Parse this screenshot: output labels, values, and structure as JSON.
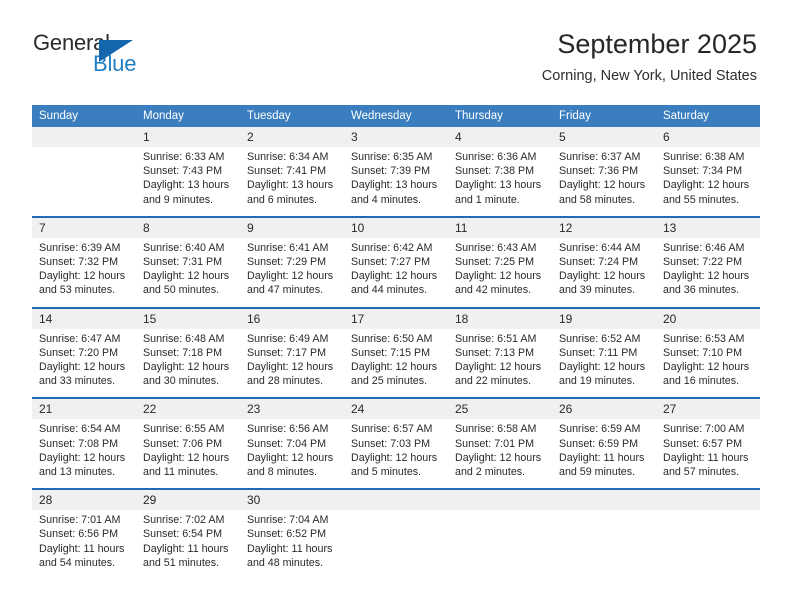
{
  "brand": {
    "line1": "General",
    "line2": "Blue"
  },
  "header": {
    "title": "September 2025",
    "subtitle": "Corning, New York, United States"
  },
  "colors": {
    "header_blue": "#3a7ebf",
    "rule_blue": "#1f6cb0",
    "brand_blue": "#1f7fc4",
    "band_gray": "#f0f0f0"
  },
  "weekday_headers": [
    "Sunday",
    "Monday",
    "Tuesday",
    "Wednesday",
    "Thursday",
    "Friday",
    "Saturday"
  ],
  "weeks": [
    [
      {
        "day": "",
        "sunrise": "",
        "sunset": "",
        "daylight_a": "",
        "daylight_b": ""
      },
      {
        "day": "1",
        "sunrise": "Sunrise: 6:33 AM",
        "sunset": "Sunset: 7:43 PM",
        "daylight_a": "Daylight: 13 hours",
        "daylight_b": "and 9 minutes."
      },
      {
        "day": "2",
        "sunrise": "Sunrise: 6:34 AM",
        "sunset": "Sunset: 7:41 PM",
        "daylight_a": "Daylight: 13 hours",
        "daylight_b": "and 6 minutes."
      },
      {
        "day": "3",
        "sunrise": "Sunrise: 6:35 AM",
        "sunset": "Sunset: 7:39 PM",
        "daylight_a": "Daylight: 13 hours",
        "daylight_b": "and 4 minutes."
      },
      {
        "day": "4",
        "sunrise": "Sunrise: 6:36 AM",
        "sunset": "Sunset: 7:38 PM",
        "daylight_a": "Daylight: 13 hours",
        "daylight_b": "and 1 minute."
      },
      {
        "day": "5",
        "sunrise": "Sunrise: 6:37 AM",
        "sunset": "Sunset: 7:36 PM",
        "daylight_a": "Daylight: 12 hours",
        "daylight_b": "and 58 minutes."
      },
      {
        "day": "6",
        "sunrise": "Sunrise: 6:38 AM",
        "sunset": "Sunset: 7:34 PM",
        "daylight_a": "Daylight: 12 hours",
        "daylight_b": "and 55 minutes."
      }
    ],
    [
      {
        "day": "7",
        "sunrise": "Sunrise: 6:39 AM",
        "sunset": "Sunset: 7:32 PM",
        "daylight_a": "Daylight: 12 hours",
        "daylight_b": "and 53 minutes."
      },
      {
        "day": "8",
        "sunrise": "Sunrise: 6:40 AM",
        "sunset": "Sunset: 7:31 PM",
        "daylight_a": "Daylight: 12 hours",
        "daylight_b": "and 50 minutes."
      },
      {
        "day": "9",
        "sunrise": "Sunrise: 6:41 AM",
        "sunset": "Sunset: 7:29 PM",
        "daylight_a": "Daylight: 12 hours",
        "daylight_b": "and 47 minutes."
      },
      {
        "day": "10",
        "sunrise": "Sunrise: 6:42 AM",
        "sunset": "Sunset: 7:27 PM",
        "daylight_a": "Daylight: 12 hours",
        "daylight_b": "and 44 minutes."
      },
      {
        "day": "11",
        "sunrise": "Sunrise: 6:43 AM",
        "sunset": "Sunset: 7:25 PM",
        "daylight_a": "Daylight: 12 hours",
        "daylight_b": "and 42 minutes."
      },
      {
        "day": "12",
        "sunrise": "Sunrise: 6:44 AM",
        "sunset": "Sunset: 7:24 PM",
        "daylight_a": "Daylight: 12 hours",
        "daylight_b": "and 39 minutes."
      },
      {
        "day": "13",
        "sunrise": "Sunrise: 6:46 AM",
        "sunset": "Sunset: 7:22 PM",
        "daylight_a": "Daylight: 12 hours",
        "daylight_b": "and 36 minutes."
      }
    ],
    [
      {
        "day": "14",
        "sunrise": "Sunrise: 6:47 AM",
        "sunset": "Sunset: 7:20 PM",
        "daylight_a": "Daylight: 12 hours",
        "daylight_b": "and 33 minutes."
      },
      {
        "day": "15",
        "sunrise": "Sunrise: 6:48 AM",
        "sunset": "Sunset: 7:18 PM",
        "daylight_a": "Daylight: 12 hours",
        "daylight_b": "and 30 minutes."
      },
      {
        "day": "16",
        "sunrise": "Sunrise: 6:49 AM",
        "sunset": "Sunset: 7:17 PM",
        "daylight_a": "Daylight: 12 hours",
        "daylight_b": "and 28 minutes."
      },
      {
        "day": "17",
        "sunrise": "Sunrise: 6:50 AM",
        "sunset": "Sunset: 7:15 PM",
        "daylight_a": "Daylight: 12 hours",
        "daylight_b": "and 25 minutes."
      },
      {
        "day": "18",
        "sunrise": "Sunrise: 6:51 AM",
        "sunset": "Sunset: 7:13 PM",
        "daylight_a": "Daylight: 12 hours",
        "daylight_b": "and 22 minutes."
      },
      {
        "day": "19",
        "sunrise": "Sunrise: 6:52 AM",
        "sunset": "Sunset: 7:11 PM",
        "daylight_a": "Daylight: 12 hours",
        "daylight_b": "and 19 minutes."
      },
      {
        "day": "20",
        "sunrise": "Sunrise: 6:53 AM",
        "sunset": "Sunset: 7:10 PM",
        "daylight_a": "Daylight: 12 hours",
        "daylight_b": "and 16 minutes."
      }
    ],
    [
      {
        "day": "21",
        "sunrise": "Sunrise: 6:54 AM",
        "sunset": "Sunset: 7:08 PM",
        "daylight_a": "Daylight: 12 hours",
        "daylight_b": "and 13 minutes."
      },
      {
        "day": "22",
        "sunrise": "Sunrise: 6:55 AM",
        "sunset": "Sunset: 7:06 PM",
        "daylight_a": "Daylight: 12 hours",
        "daylight_b": "and 11 minutes."
      },
      {
        "day": "23",
        "sunrise": "Sunrise: 6:56 AM",
        "sunset": "Sunset: 7:04 PM",
        "daylight_a": "Daylight: 12 hours",
        "daylight_b": "and 8 minutes."
      },
      {
        "day": "24",
        "sunrise": "Sunrise: 6:57 AM",
        "sunset": "Sunset: 7:03 PM",
        "daylight_a": "Daylight: 12 hours",
        "daylight_b": "and 5 minutes."
      },
      {
        "day": "25",
        "sunrise": "Sunrise: 6:58 AM",
        "sunset": "Sunset: 7:01 PM",
        "daylight_a": "Daylight: 12 hours",
        "daylight_b": "and 2 minutes."
      },
      {
        "day": "26",
        "sunrise": "Sunrise: 6:59 AM",
        "sunset": "Sunset: 6:59 PM",
        "daylight_a": "Daylight: 11 hours",
        "daylight_b": "and 59 minutes."
      },
      {
        "day": "27",
        "sunrise": "Sunrise: 7:00 AM",
        "sunset": "Sunset: 6:57 PM",
        "daylight_a": "Daylight: 11 hours",
        "daylight_b": "and 57 minutes."
      }
    ],
    [
      {
        "day": "28",
        "sunrise": "Sunrise: 7:01 AM",
        "sunset": "Sunset: 6:56 PM",
        "daylight_a": "Daylight: 11 hours",
        "daylight_b": "and 54 minutes."
      },
      {
        "day": "29",
        "sunrise": "Sunrise: 7:02 AM",
        "sunset": "Sunset: 6:54 PM",
        "daylight_a": "Daylight: 11 hours",
        "daylight_b": "and 51 minutes."
      },
      {
        "day": "30",
        "sunrise": "Sunrise: 7:04 AM",
        "sunset": "Sunset: 6:52 PM",
        "daylight_a": "Daylight: 11 hours",
        "daylight_b": "and 48 minutes."
      },
      {
        "day": "",
        "sunrise": "",
        "sunset": "",
        "daylight_a": "",
        "daylight_b": ""
      },
      {
        "day": "",
        "sunrise": "",
        "sunset": "",
        "daylight_a": "",
        "daylight_b": ""
      },
      {
        "day": "",
        "sunrise": "",
        "sunset": "",
        "daylight_a": "",
        "daylight_b": ""
      },
      {
        "day": "",
        "sunrise": "",
        "sunset": "",
        "daylight_a": "",
        "daylight_b": ""
      }
    ]
  ]
}
